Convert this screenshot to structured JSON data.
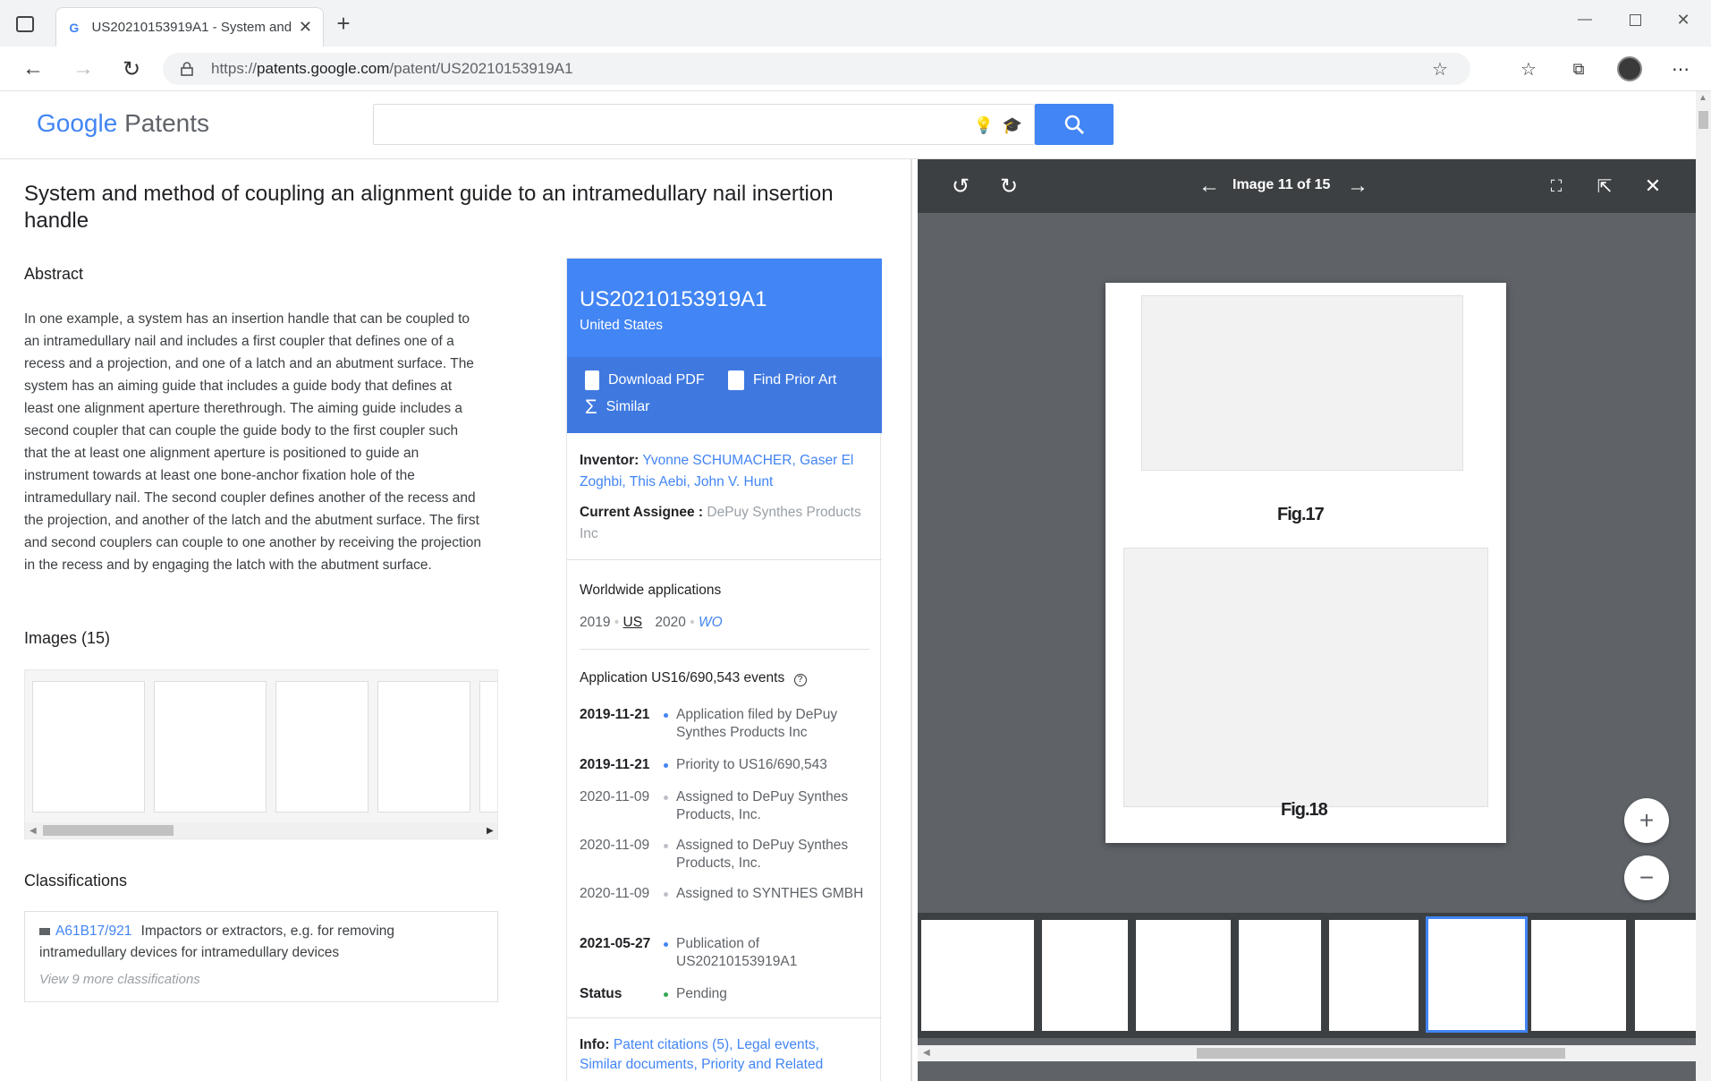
{
  "browser": {
    "tab_title": "US20210153919A1 - System and",
    "url_prefix": "https://",
    "url_host": "patents.google.com",
    "url_path": "/patent/US20210153919A1"
  },
  "header": {
    "logo_google": "Google",
    "logo_patents": "Patents",
    "search_placeholder": ""
  },
  "patent": {
    "title": "System and method of coupling an alignment guide to an intramedullary nail insertion handle",
    "abstract_heading": "Abstract",
    "abstract": "In one example, a system has an insertion handle that can be coupled to an intramedullary nail and includes a first coupler that defines one of a recess and a projection, and one of a latch and an abutment surface. The system has an aiming guide that includes a guide body that defines at least one alignment aperture therethrough. The aiming guide includes a second coupler that can couple the guide body to the first coupler such that the at least one alignment aperture is positioned to guide an instrument towards at least one bone-anchor fixation hole of the intramedullary nail. The second coupler defines another of the recess and the projection, and another of the latch and the abutment surface. The first and second couplers can couple to one another by receiving the projection in the recess and by engaging the latch with the abutment surface.",
    "images_heading": "Images (15)",
    "classifications_heading": "Classifications",
    "classification_code": "A61B17/921",
    "classification_text": "Impactors or extractors, e.g. for removing intramedullary devices for intramedullary devices",
    "more_classifications": "View 9 more classifications"
  },
  "card": {
    "number": "US20210153919A1",
    "country": "United States",
    "download_pdf": "Download PDF",
    "find_prior_art": "Find Prior Art",
    "similar": "Similar",
    "inventor_label": "Inventor:",
    "inventors": "Yvonne SCHUMACHER, Gaser El Zoghbi, This Aebi, John V. Hunt",
    "assignee_label": "Current Assignee :",
    "assignee": "DePuy Synthes Products Inc",
    "worldwide_heading": "Worldwide applications",
    "ww_year1": "2019",
    "ww_code1": "US",
    "ww_year2": "2020",
    "ww_code2": "WO",
    "events_heading": "Application US16/690,543 events",
    "events": [
      {
        "date": "2019-11-21",
        "text": "Application filed by DePuy Synthes Products Inc"
      },
      {
        "date": "2019-11-21",
        "text": "Priority to US16/690,543"
      },
      {
        "date": "2020-11-09",
        "text": "Assigned to DePuy Synthes Products, Inc."
      },
      {
        "date": "2020-11-09",
        "text": "Assigned to DePuy Synthes Products, Inc."
      },
      {
        "date": "2020-11-09",
        "text": "Assigned to SYNTHES GMBH"
      },
      {
        "date": "2021-05-27",
        "text": "Publication of US20210153919A1"
      }
    ],
    "status_label": "Status",
    "status_value": "Pending",
    "info_label": "Info:",
    "info_links": "Patent citations (5), Legal events,",
    "info_links2": "Similar documents, Priority and Related"
  },
  "viewer": {
    "image_counter": "Image 11 of 15",
    "fig_labels": [
      "Fig.17",
      "Fig.18"
    ]
  },
  "colors": {
    "accent": "#4285f4",
    "viewer_bg": "#5f6368",
    "viewer_bar": "#3c4043"
  }
}
